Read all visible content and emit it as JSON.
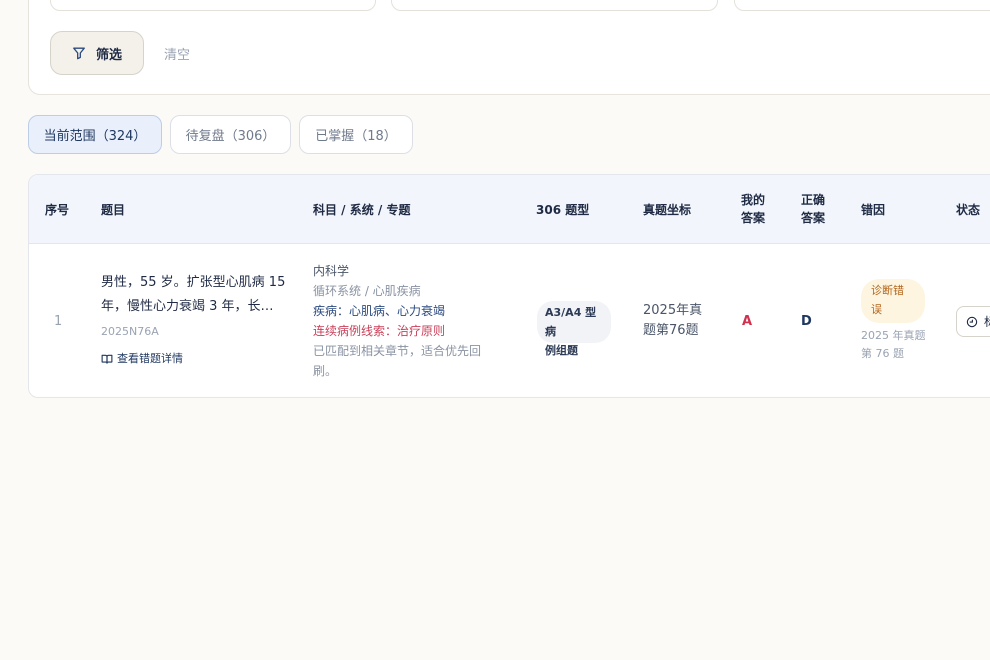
{
  "filter": {
    "filter_button": "筛选",
    "clear_link": "清空"
  },
  "tabs": [
    {
      "label": "当前范围（324）",
      "active": true
    },
    {
      "label": "待复盘（306）",
      "active": false
    },
    {
      "label": "已掌握（18）",
      "active": false
    }
  ],
  "table": {
    "headers": {
      "index": "序号",
      "question": "题目",
      "subject": "科目 / 系统 / 专题",
      "type": "306 题型",
      "coord": "真题坐标",
      "my_answer_l1": "我的",
      "my_answer_l2": "答案",
      "correct_answer_l1": "正确",
      "correct_answer_l2": "答案",
      "error_cause": "错因",
      "status": "状态"
    },
    "rows": [
      {
        "index": "1",
        "question_line1": "男性，55 岁。扩张型心肌病 15",
        "question_line2": "年，慢性心力衰竭 3 年，长…",
        "code": "2025N76A",
        "detail_link": "查看错题详情",
        "subject_l1": "内科学",
        "subject_l2": "循环系统 / 心肌疾病",
        "subject_l3": "疾病：心肌病、心力衰竭",
        "subject_l4": "连续病例线索：治疗原则",
        "subject_l5": "已匹配到相关章节，适合优先回刷。",
        "type_line1": "A3/A4 型病",
        "type_line2": "例组题",
        "coord_line1": "2025年真",
        "coord_line2": "题第76题",
        "my_answer": "A",
        "correct_answer": "D",
        "error_line1": "诊断错",
        "error_line2": "误",
        "error_src_line1": "2025 年真题",
        "error_src_line2": "第 76 题",
        "status_label": "标"
      }
    ]
  }
}
